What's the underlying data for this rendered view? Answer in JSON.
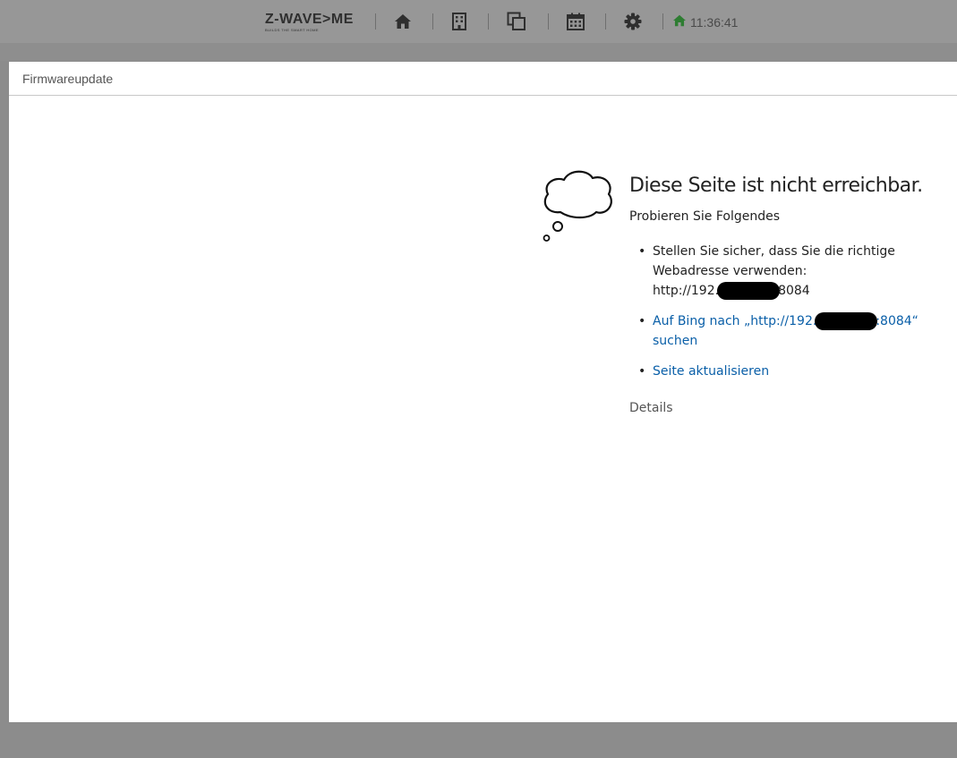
{
  "navbar": {
    "logo_text": "Z-WAVE>ME",
    "logo_tagline": "BUILDS THE SMART HOME",
    "icons": [
      "home-icon",
      "building-icon",
      "elements-icon",
      "calendar-icon",
      "gear-icon"
    ],
    "time": "11:36:41",
    "status_color": "#2e7d32"
  },
  "panel": {
    "title": "Firmwareupdate"
  },
  "error_page": {
    "title": "Diese Seite ist nicht erreichbar.",
    "try_heading": "Probieren Sie Folgendes",
    "suggestion_1_line1": "Stellen Sie sicher, dass Sie die richtige",
    "suggestion_1_line2": "Webadresse verwenden:",
    "suggestion_1_url_start": "http://192.",
    "suggestion_1_url_end": "8084",
    "suggestion_2_start": "Auf Bing nach „http://192.",
    "suggestion_2_end": ":8084“",
    "suggestion_2_line2": "suchen",
    "suggestion_3": "Seite aktualisieren",
    "details": "Details",
    "bullet": "•",
    "link_color": "#0a5fa8"
  }
}
